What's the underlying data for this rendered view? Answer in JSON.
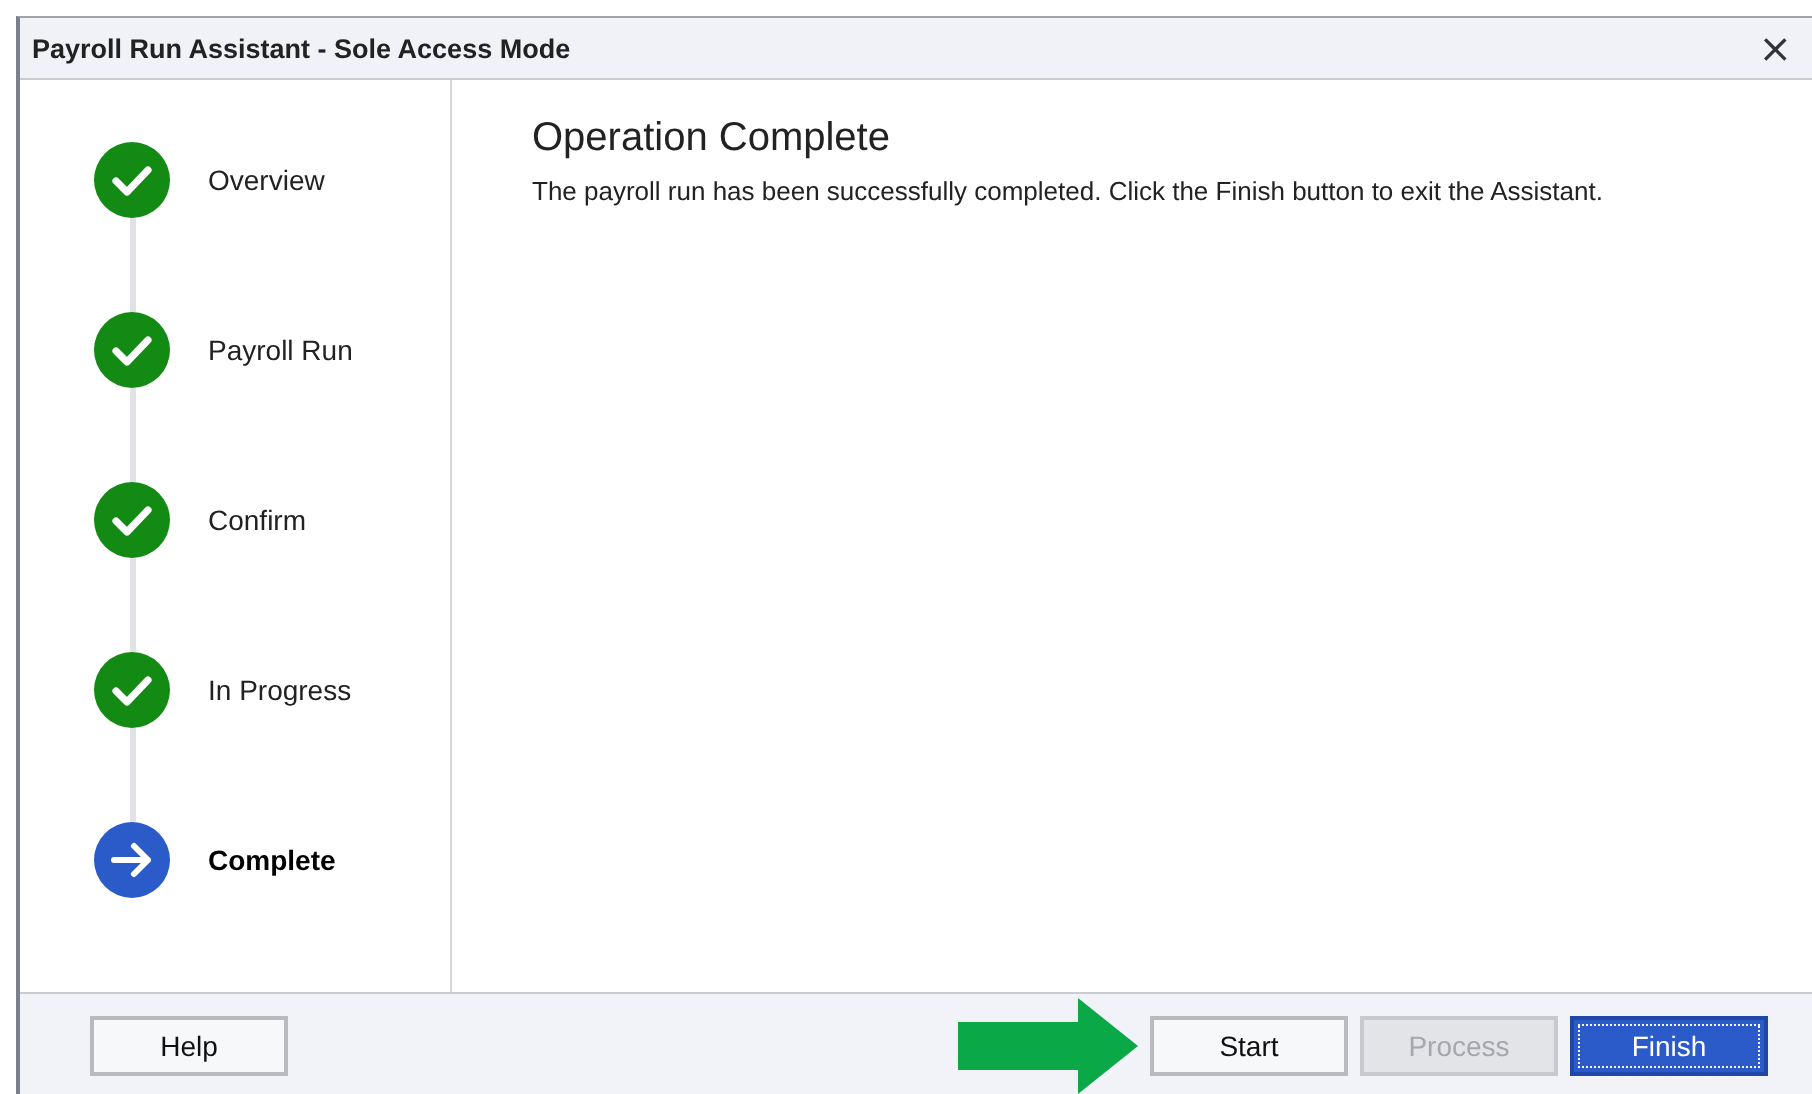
{
  "window": {
    "title": "Payroll Run Assistant - Sole Access Mode",
    "close": "×"
  },
  "steps": [
    {
      "label": "Overview",
      "kind": "done",
      "selected": false
    },
    {
      "label": "Payroll Run",
      "kind": "done",
      "selected": false
    },
    {
      "label": "Confirm",
      "kind": "done",
      "selected": false
    },
    {
      "label": "In Progress",
      "kind": "done",
      "selected": false
    },
    {
      "label": "Complete",
      "kind": "current",
      "selected": true
    }
  ],
  "content": {
    "heading": "Operation Complete",
    "message": "The payroll run has been successfully completed. Click the Finish button to exit the Assistant."
  },
  "buttons": [
    {
      "label": "Help",
      "disabled": false,
      "default": false
    },
    {
      "label": "Start",
      "disabled": false,
      "default": false
    },
    {
      "label": "Process",
      "disabled": true,
      "default": false
    },
    {
      "label": "Finish",
      "disabled": false,
      "default": true
    }
  ]
}
